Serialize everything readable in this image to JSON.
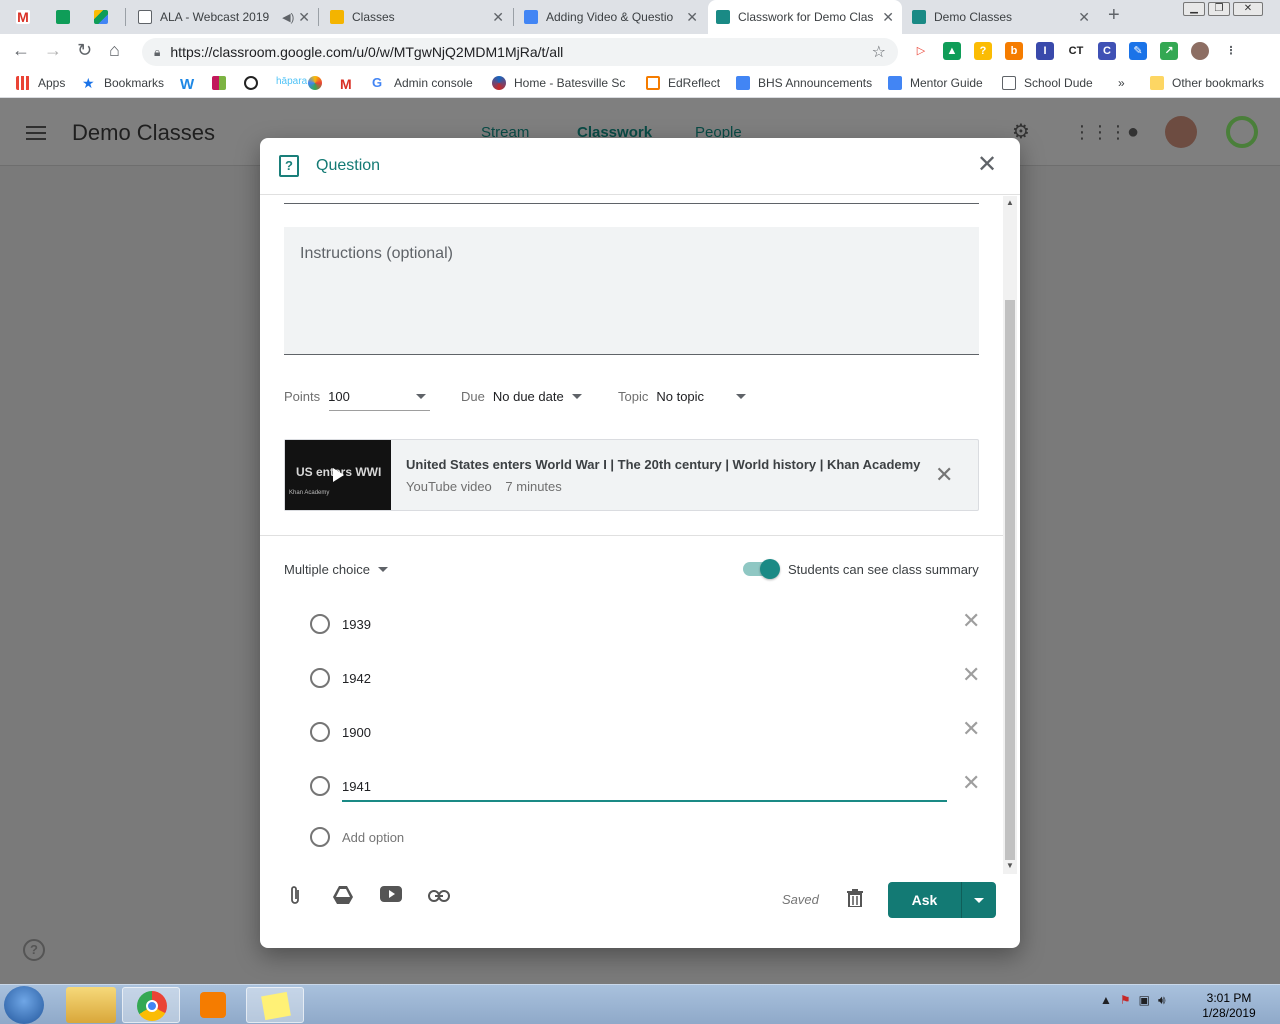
{
  "browser": {
    "tabs": [
      {
        "title": "",
        "icon": "gmail-icon"
      },
      {
        "title": "",
        "icon": "sheets-icon"
      },
      {
        "title": "",
        "icon": "drive-icon"
      },
      {
        "title": "ALA - Webcast 2019",
        "icon": "doc-icon"
      },
      {
        "title": "Classes",
        "icon": "slides-icon"
      },
      {
        "title": "Adding Video & Questio",
        "icon": "docs-icon"
      },
      {
        "title": "Classwork for Demo Clas",
        "icon": "classroom-icon",
        "active": true
      },
      {
        "title": "Demo Classes",
        "icon": "classroom-icon"
      }
    ],
    "url": "https://classroom.google.com/u/0/w/MTgwNjQ2MDM1MjRa/t/all",
    "bookmarks": [
      {
        "label": "Apps"
      },
      {
        "label": "Bookmarks"
      },
      {
        "label": "Admin console"
      },
      {
        "label": "Home - Batesville Sc"
      },
      {
        "label": "EdReflect"
      },
      {
        "label": "BHS Announcements"
      },
      {
        "label": "Mentor Guide"
      },
      {
        "label": "School Dude"
      },
      {
        "label": "»"
      },
      {
        "label": "Other bookmarks"
      }
    ]
  },
  "app": {
    "title": "Demo Classes",
    "tabs": [
      "Stream",
      "Classwork",
      "People"
    ]
  },
  "dialog": {
    "title": "Question",
    "instructions_placeholder": "Instructions (optional)",
    "points_label": "Points",
    "points_value": "100",
    "due_label": "Due",
    "due_value": "No due date",
    "topic_label": "Topic",
    "topic_value": "No topic",
    "attachment": {
      "title": "United States enters World War I | The 20th century | World history | Khan Academy",
      "type": "YouTube video",
      "duration": "7 minutes",
      "thumb_text": "US enters WWI",
      "thumb_brand": "Khan Academy"
    },
    "question_type": "Multiple choice",
    "summary_toggle_label": "Students can see class summary",
    "summary_toggle_on": true,
    "options": [
      "1939",
      "1942",
      "1900",
      "1941"
    ],
    "add_option": "Add option",
    "saved": "Saved",
    "ask_label": "Ask"
  },
  "taskbar": {
    "time": "3:01 PM",
    "date": "1/28/2019"
  },
  "colors": {
    "accent": "#137a74",
    "dim_overlay": "#7a7a7a"
  }
}
